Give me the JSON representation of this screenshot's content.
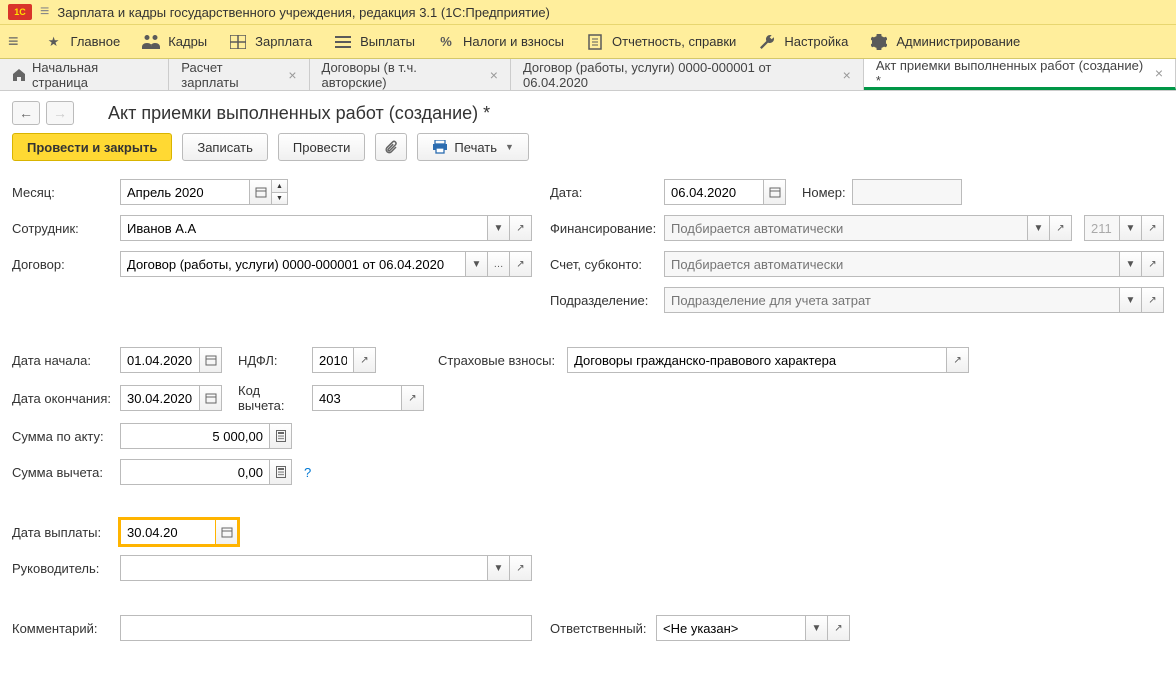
{
  "app": {
    "title": "Зарплата и кадры государственного учреждения, редакция 3.1  (1С:Предприятие)"
  },
  "menu": {
    "main": "Главное",
    "staff": "Кадры",
    "salary": "Зарплата",
    "payments": "Выплаты",
    "taxes": "Налоги и взносы",
    "reports": "Отчетность, справки",
    "settings": "Настройка",
    "admin": "Администрирование"
  },
  "tabs": {
    "home": "Начальная страница",
    "calc": "Расчет зарплаты",
    "contracts": "Договоры (в т.ч. авторские)",
    "contract": "Договор (работы, услуги) 0000-000001 от 06.04.2020",
    "act": "Акт приемки выполненных работ (создание) *"
  },
  "page": {
    "title": "Акт приемки выполненных работ (создание) *"
  },
  "actions": {
    "postAndClose": "Провести и закрыть",
    "save": "Записать",
    "post": "Провести",
    "print": "Печать"
  },
  "fields": {
    "month_label": "Месяц:",
    "month_value": "Апрель 2020",
    "date_label": "Дата:",
    "date_value": "06.04.2020",
    "number_label": "Номер:",
    "number_value": "",
    "employee_label": "Сотрудник:",
    "employee_value": "Иванов А.А",
    "financing_label": "Финансирование:",
    "financing_placeholder": "Подбирается автоматически",
    "financing_code": "211",
    "contract_label": "Договор:",
    "contract_value": "Договор (работы, услуги) 0000-000001 от 06.04.2020",
    "account_label": "Счет, субконто:",
    "account_placeholder": "Подбирается автоматически",
    "dept_label": "Подразделение:",
    "dept_placeholder": "Подразделение для учета затрат",
    "start_label": "Дата начала:",
    "start_value": "01.04.2020",
    "ndfl_label": "НДФЛ:",
    "ndfl_value": "2010",
    "insurance_label": "Страховые взносы:",
    "insurance_value": "Договоры гражданско-правового характера",
    "end_label": "Дата окончания:",
    "end_value": "30.04.2020",
    "deduction_code_label": "Код вычета:",
    "deduction_code_value": "403",
    "sum_label": "Сумма по акту:",
    "sum_value": "5 000,00",
    "deduction_sum_label": "Сумма вычета:",
    "deduction_sum_value": "0,00",
    "payment_date_label": "Дата выплаты:",
    "payment_date_value": "30.04.20",
    "manager_label": "Руководитель:",
    "manager_value": "",
    "comment_label": "Комментарий:",
    "comment_value": "",
    "responsible_label": "Ответственный:",
    "responsible_value": "<Не указан>"
  }
}
